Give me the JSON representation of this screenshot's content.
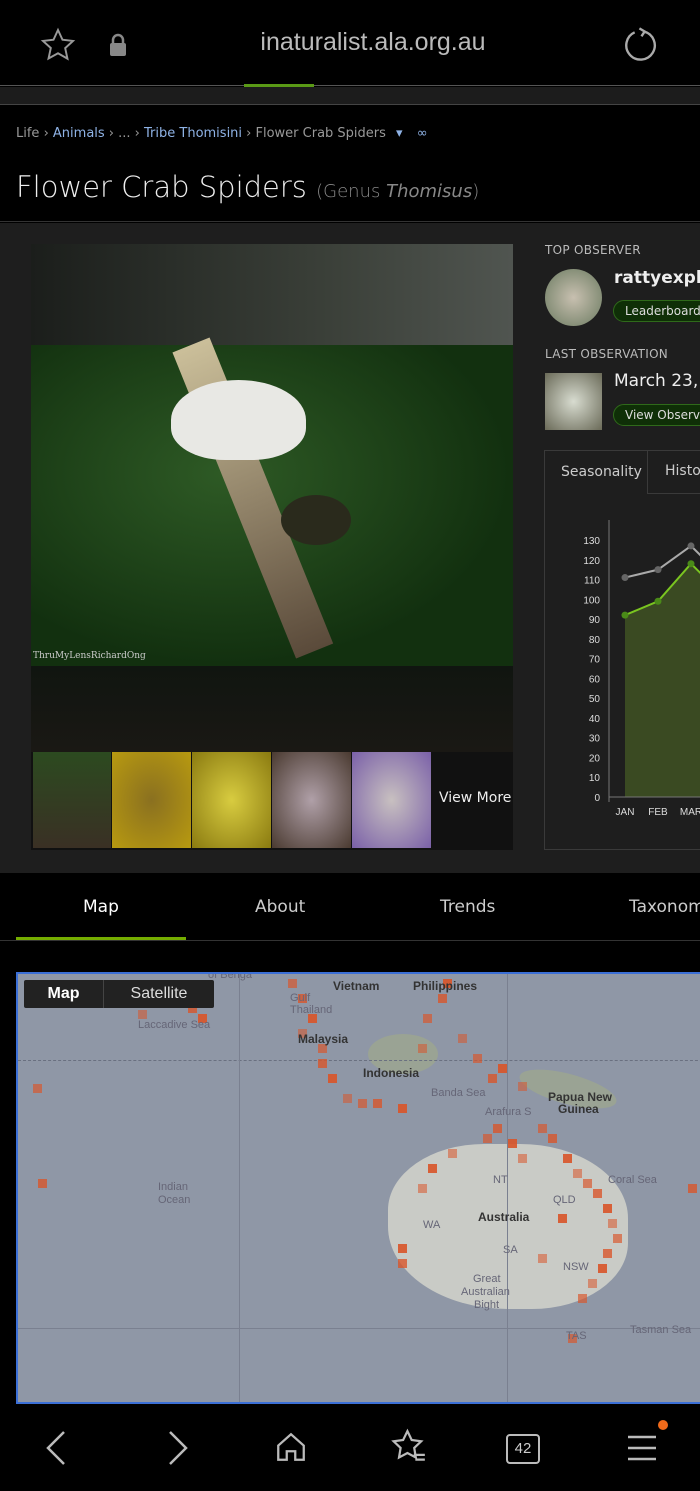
{
  "browser": {
    "url": "inaturalist.ala.org.au",
    "tab_count": "42"
  },
  "breadcrumb": {
    "items": [
      "Life",
      "Animals",
      "...",
      "Tribe Thomisini",
      "Flower Crab Spiders"
    ]
  },
  "taxon": {
    "common_name": "Flower Crab Spiders",
    "rank_prefix": "(Genus ",
    "scientific_name": "Thomisus",
    "rank_suffix": ")"
  },
  "photo": {
    "credit": "ThruMyLensRichardOng",
    "view_more": "View More"
  },
  "top_observer": {
    "label": "TOP OBSERVER",
    "name": "rattyexplor",
    "button": "Leaderboard"
  },
  "last_observation": {
    "label": "LAST OBSERVATION",
    "date": "March 23, ",
    "button": "View Observat"
  },
  "chart_tabs": [
    "Seasonality",
    "Histor"
  ],
  "chart_data": {
    "type": "line",
    "categories": [
      "JAN",
      "FEB",
      "MAR"
    ],
    "ylim": [
      0,
      130
    ],
    "yticks": [
      0,
      10,
      20,
      30,
      40,
      50,
      60,
      70,
      80,
      90,
      100,
      110,
      120,
      130
    ],
    "series": [
      {
        "color": "#aaaaaa",
        "values": [
          111,
          115,
          127
        ]
      },
      {
        "color": "#7ac520",
        "fill": "#3a4a22",
        "values": [
          92,
          99,
          118
        ]
      }
    ]
  },
  "tabs": [
    "Map",
    "About",
    "Trends",
    "Taxonom"
  ],
  "map": {
    "toggle": [
      "Map",
      "Satellite"
    ],
    "labels": [
      "of Benga",
      "Vietnam",
      "Philippines",
      "Gulf",
      "Thailand",
      "Laccadive Sea",
      "Malaysia",
      "Indonesia",
      "Banda Sea",
      "Arafura S",
      "Papua New",
      "Guinea",
      "Indian",
      "Ocean",
      "NT",
      "QLD",
      "Coral Sea",
      "Australia",
      "WA",
      "SA",
      "NSW",
      "Great",
      "Australian",
      "Bight",
      "Tasman Sea",
      "TAS"
    ]
  },
  "colors": {
    "accent": "#74ac00",
    "link": "#8fb3e6",
    "observation_cell": "#d9552a"
  }
}
